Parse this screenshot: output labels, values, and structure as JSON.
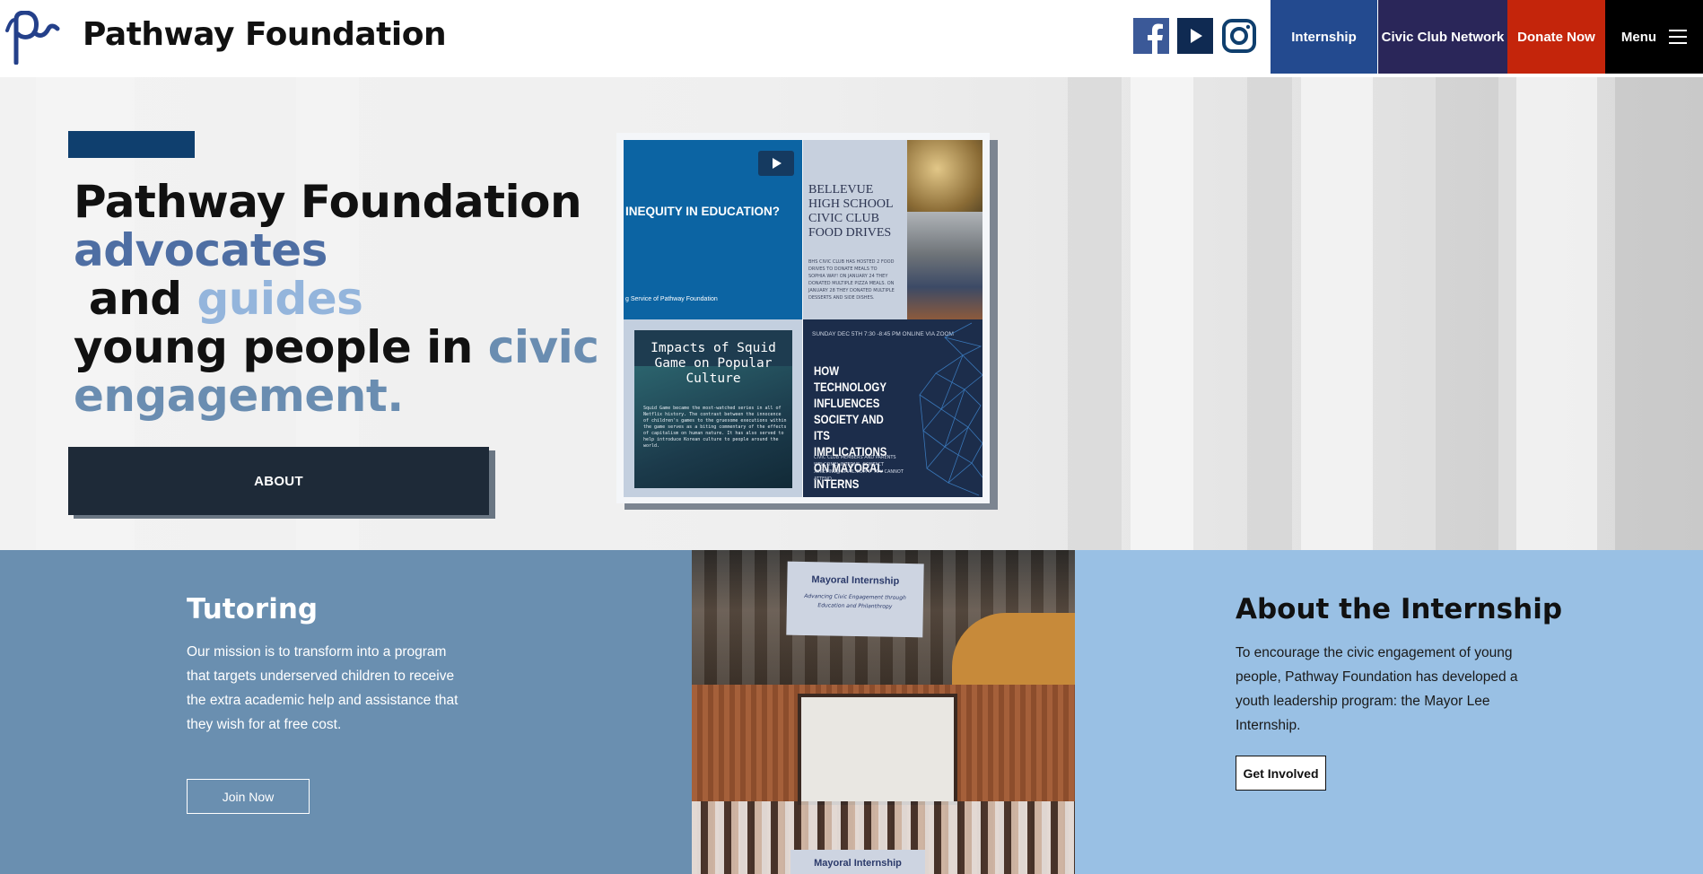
{
  "header": {
    "site_title": "Pathway Foundation",
    "social": [
      {
        "name": "facebook-icon",
        "color": "#3b5998"
      },
      {
        "name": "youtube-icon",
        "color": "#0f2a52"
      },
      {
        "name": "instagram-icon",
        "color": "#0f3f6e"
      }
    ],
    "nav": {
      "internship": "Internship",
      "civic_club": "Civic Club Network",
      "donate": "Donate Now",
      "menu": "Menu"
    },
    "colors": {
      "internship": "#234a8f",
      "civic_club": "#2a2659",
      "donate": "#c4250b",
      "menu": "#000000"
    }
  },
  "hero": {
    "headline": {
      "line1": "Pathway Foundation",
      "w_advocates": "advocates",
      "w_and": " and ",
      "w_guides": "guides",
      "w_young": "young people in ",
      "w_civic": "civic",
      "w_engagement": "engagement."
    },
    "about_button": "ABOUT",
    "collage": {
      "tile1_question": "INEQUITY IN EDUCATION?",
      "tile1_caption": "g Service of Pathway Foundation",
      "tile2_title": "BELLEVUE HIGH SCHOOL CIVIC CLUB FOOD DRIVES",
      "tile2_fine": "BHS CIVIC CLUB HAS HOSTED 2 FOOD DRIVES TO DONATE MEALS TO SOPHIA WAY! ON JANUARY 24 THEY DONATED MULTIPLE PIZZA MEALS. ON JANUARY 28 THEY DONATED MULTIPLE DESSERTS AND SIDE DISHES.",
      "tile3_title": "Impacts of Squid Game on Popular Culture",
      "tile3_fine": "Squid Game became the most-watched series in all of Netflix history. The contrast between the innocence of children's games to the gruesome executions within the game serves as a biting commentary of the effects of capitalism on human nature. It has also served to help introduce Korean culture to people around the world.",
      "tile4_date": "SUNDAY DEC 5TH 7:30 -8:45 PM ONLINE VIA ZOOM",
      "tile4_title": "HOW TECHNOLOGY INFLUENCES SOCIETY AND ITS IMPLICATIONS ON MAYORAL INTERNS",
      "tile4_fine": "CIVIC CLUB MEMBERS AND PARENTS WELCOME! INTERNS, CONTACT XCKEVINS@GMAIL.COM IF YOU CANNOT ATTEND."
    }
  },
  "tutoring": {
    "title": "Tutoring",
    "body": "Our mission is to transform into a program that targets underserved children to receive the extra academic help and assistance that they wish for at free cost.",
    "button": "Join Now"
  },
  "photo": {
    "banner_top": "Mayoral Internship",
    "banner_top_sub": "Advancing Civic Engagement through Education and Philanthropy",
    "banner_bottom": "Mayoral Internship"
  },
  "internship": {
    "title": "About the Internship",
    "body": "To encourage the civic engagement of young people, Pathway Foundation has developed a youth leadership program: the Mayor Lee Internship.",
    "button": "Get Involved"
  }
}
